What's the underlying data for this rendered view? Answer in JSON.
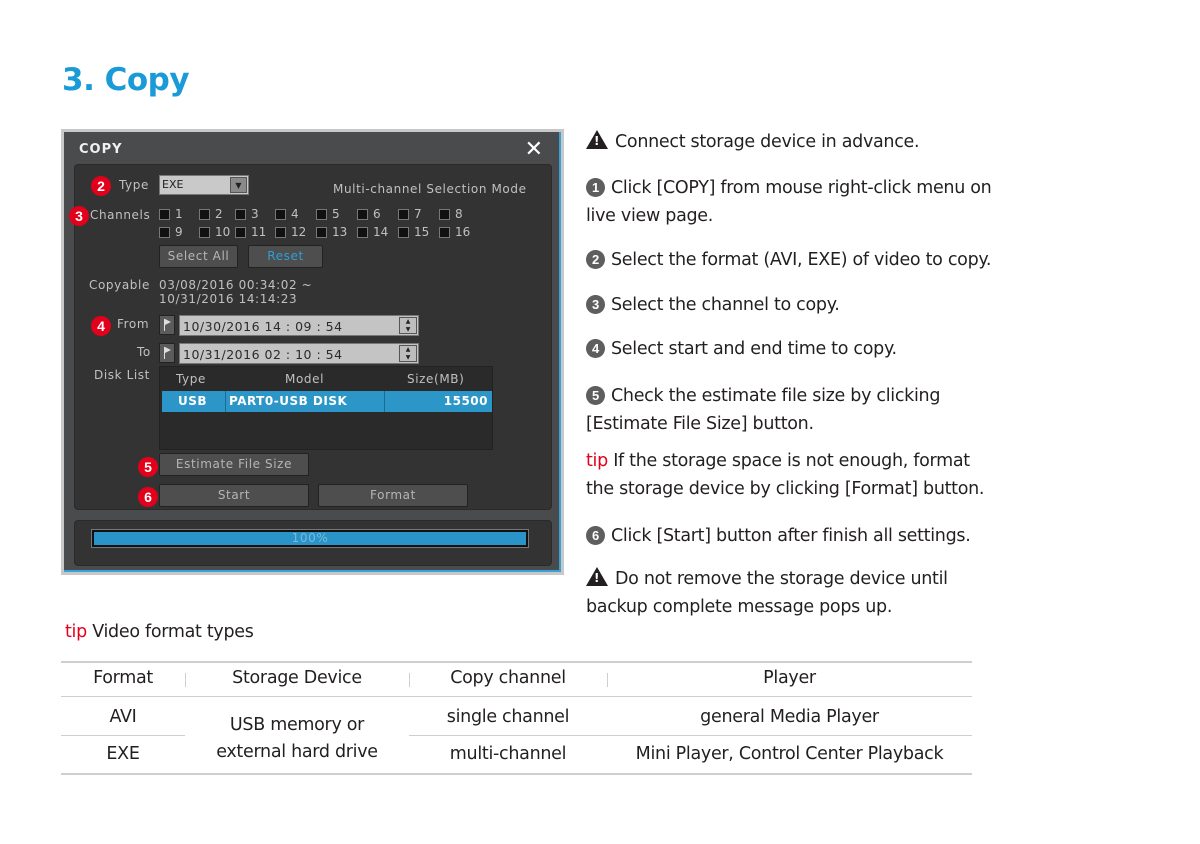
{
  "page": {
    "title": "3. Copy"
  },
  "dialog": {
    "title": "COPY",
    "close_icon": "✕",
    "type": {
      "label": "Type",
      "value": "EXE",
      "badge": "2"
    },
    "mode_label": "Multi-channel Selection Mode",
    "channels": {
      "label": "Channels",
      "badge": "3",
      "items": [
        "1",
        "2",
        "3",
        "4",
        "5",
        "6",
        "7",
        "8",
        "9",
        "10",
        "11",
        "12",
        "13",
        "14",
        "15",
        "16"
      ]
    },
    "select_all_label": "Select All",
    "reset_label": "Reset",
    "copyable": {
      "label": "Copyable",
      "line1": "03/08/2016  00:34:02 ~",
      "line2": "10/31/2016  14:14:23"
    },
    "from": {
      "label": "From",
      "badge": "4",
      "value": "10/30/2016  14 : 09 : 54"
    },
    "to": {
      "label": "To",
      "value": "10/31/2016  02 : 10 : 54"
    },
    "disk_list": {
      "label": "Disk List",
      "columns": [
        "Type",
        "Model",
        "Size(MB)"
      ],
      "rows": [
        {
          "type": "USB",
          "model": "PART0-USB DISK",
          "size": "15500"
        }
      ]
    },
    "estimate_label": "Estimate File Size",
    "estimate_badge": "5",
    "start_label": "Start",
    "start_badge": "6",
    "format_label": "Format",
    "progress": {
      "percent": 100,
      "text": "100%"
    }
  },
  "instructions": {
    "warn1": "Connect storage device in advance.",
    "step1_num": "1",
    "step1": "Click [COPY] from mouse right-click menu on live view page.",
    "step2_num": "2",
    "step2": "Select the format (AVI, EXE) of video to copy.",
    "step3_num": "3",
    "step3": "Select the channel to copy.",
    "step4_num": "4",
    "step4": "Select start and end time to copy.",
    "step5_num": "5",
    "step5": "Check the estimate file size by clicking [Estimate File Size] button.",
    "tip_word": "tip",
    "tip": " If the storage space is not enough, format the storage device by clicking [Format] button.",
    "step6_num": "6",
    "step6": "Click [Start] button after finish all settings.",
    "warn2": "Do not remove the storage device until backup complete message pops up."
  },
  "format_table": {
    "tip_word": "tip",
    "title": " Video format types",
    "headers": [
      "Format",
      "Storage Device",
      "Copy channel",
      "Player"
    ],
    "rows": [
      {
        "format": "AVI",
        "channel": "single channel",
        "player": "general Media Player"
      },
      {
        "format": "EXE",
        "channel": "multi-channel",
        "player": "Mini Player, Control Center Playback"
      }
    ],
    "storage_line1": "USB memory or",
    "storage_line2": "external hard drive"
  }
}
